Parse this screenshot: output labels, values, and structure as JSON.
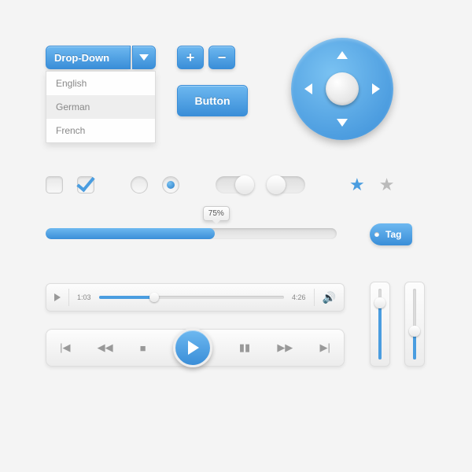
{
  "dropdown": {
    "label": "Drop-Down",
    "options": [
      "English",
      "German",
      "French"
    ],
    "hover_index": 1
  },
  "plusminus": {
    "plus": "+",
    "minus": "−"
  },
  "button": {
    "label": "Button"
  },
  "progress": {
    "percent_label": "75%",
    "value": 58
  },
  "tag": {
    "label": "Tag"
  },
  "player": {
    "current_time": "1:03",
    "total_time": "4:26",
    "position_pct": 30
  },
  "vsliders": [
    {
      "value_pct": 75
    },
    {
      "value_pct": 35
    }
  ],
  "stars": {
    "filled": true,
    "empty": false
  },
  "checkboxes": [
    false,
    true
  ],
  "radios": [
    false,
    true
  ],
  "switches": [
    "on",
    "off"
  ],
  "colors": {
    "accent": "#4a9de0"
  }
}
